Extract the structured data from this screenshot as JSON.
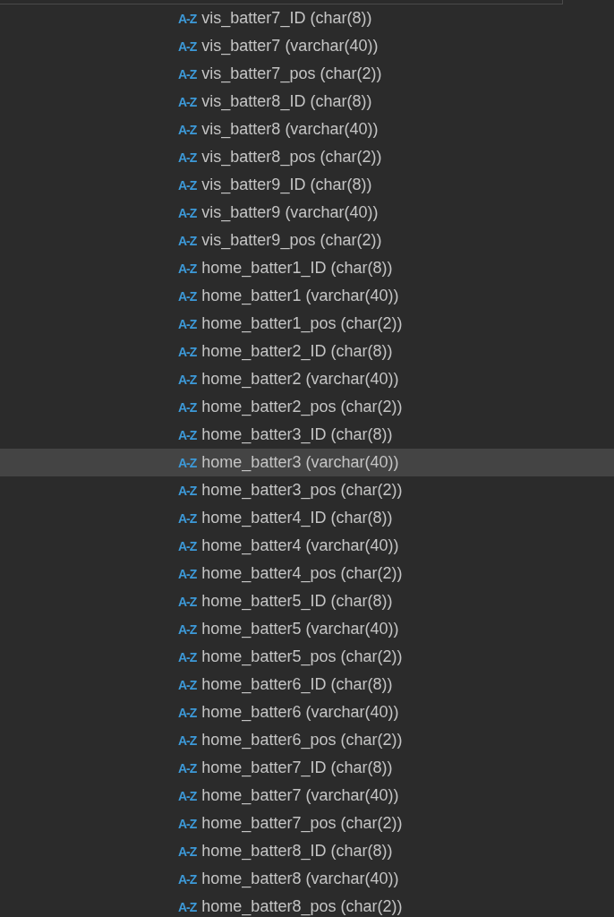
{
  "columns": [
    {
      "icon": "A-Z",
      "label": "vis_batter7_ID (char(8))",
      "selected": false
    },
    {
      "icon": "A-Z",
      "label": "vis_batter7 (varchar(40))",
      "selected": false
    },
    {
      "icon": "A-Z",
      "label": "vis_batter7_pos (char(2))",
      "selected": false
    },
    {
      "icon": "A-Z",
      "label": "vis_batter8_ID (char(8))",
      "selected": false
    },
    {
      "icon": "A-Z",
      "label": "vis_batter8 (varchar(40))",
      "selected": false
    },
    {
      "icon": "A-Z",
      "label": "vis_batter8_pos (char(2))",
      "selected": false
    },
    {
      "icon": "A-Z",
      "label": "vis_batter9_ID (char(8))",
      "selected": false
    },
    {
      "icon": "A-Z",
      "label": "vis_batter9 (varchar(40))",
      "selected": false
    },
    {
      "icon": "A-Z",
      "label": "vis_batter9_pos (char(2))",
      "selected": false
    },
    {
      "icon": "A-Z",
      "label": "home_batter1_ID (char(8))",
      "selected": false
    },
    {
      "icon": "A-Z",
      "label": "home_batter1 (varchar(40))",
      "selected": false
    },
    {
      "icon": "A-Z",
      "label": "home_batter1_pos (char(2))",
      "selected": false
    },
    {
      "icon": "A-Z",
      "label": "home_batter2_ID (char(8))",
      "selected": false
    },
    {
      "icon": "A-Z",
      "label": "home_batter2 (varchar(40))",
      "selected": false
    },
    {
      "icon": "A-Z",
      "label": "home_batter2_pos (char(2))",
      "selected": false
    },
    {
      "icon": "A-Z",
      "label": "home_batter3_ID (char(8))",
      "selected": false
    },
    {
      "icon": "A-Z",
      "label": "home_batter3 (varchar(40))",
      "selected": true
    },
    {
      "icon": "A-Z",
      "label": "home_batter3_pos (char(2))",
      "selected": false
    },
    {
      "icon": "A-Z",
      "label": "home_batter4_ID (char(8))",
      "selected": false
    },
    {
      "icon": "A-Z",
      "label": "home_batter4 (varchar(40))",
      "selected": false
    },
    {
      "icon": "A-Z",
      "label": "home_batter4_pos (char(2))",
      "selected": false
    },
    {
      "icon": "A-Z",
      "label": "home_batter5_ID (char(8))",
      "selected": false
    },
    {
      "icon": "A-Z",
      "label": "home_batter5 (varchar(40))",
      "selected": false
    },
    {
      "icon": "A-Z",
      "label": "home_batter5_pos (char(2))",
      "selected": false
    },
    {
      "icon": "A-Z",
      "label": "home_batter6_ID (char(8))",
      "selected": false
    },
    {
      "icon": "A-Z",
      "label": "home_batter6 (varchar(40))",
      "selected": false
    },
    {
      "icon": "A-Z",
      "label": "home_batter6_pos (char(2))",
      "selected": false
    },
    {
      "icon": "A-Z",
      "label": "home_batter7_ID (char(8))",
      "selected": false
    },
    {
      "icon": "A-Z",
      "label": "home_batter7 (varchar(40))",
      "selected": false
    },
    {
      "icon": "A-Z",
      "label": "home_batter7_pos (char(2))",
      "selected": false
    },
    {
      "icon": "A-Z",
      "label": "home_batter8_ID (char(8))",
      "selected": false
    },
    {
      "icon": "A-Z",
      "label": "home_batter8 (varchar(40))",
      "selected": false
    },
    {
      "icon": "A-Z",
      "label": "home_batter8_pos (char(2))",
      "selected": false
    }
  ]
}
